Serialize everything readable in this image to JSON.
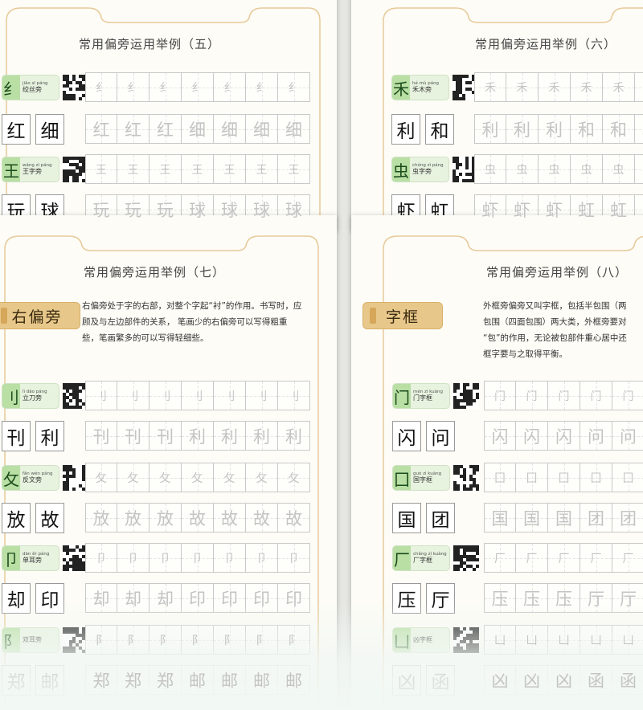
{
  "pages": [
    {
      "title": "常用偏旁运用举例（五）",
      "rows": [
        {
          "type": "head",
          "glyph": "纟",
          "pinyin": "jiǎo sī páng",
          "name": "绞丝旁",
          "trace": [
            "纟",
            "纟",
            "纟",
            "纟",
            "纟",
            "纟",
            "纟"
          ]
        },
        {
          "type": "ex",
          "ex": [
            "红",
            "细"
          ],
          "trace": [
            "红",
            "红",
            "红",
            "细",
            "细",
            "细",
            "细"
          ]
        },
        {
          "type": "head",
          "glyph": "王",
          "pinyin": "wáng zì páng",
          "name": "王字旁",
          "trace": [
            "王",
            "王",
            "王",
            "王",
            "王",
            "王",
            "王"
          ]
        },
        {
          "type": "ex",
          "ex": [
            "玩",
            "球"
          ],
          "trace": [
            "玩",
            "玩",
            "玩",
            "球",
            "球",
            "球",
            "球"
          ]
        }
      ]
    },
    {
      "title": "常用偏旁运用举例（六）",
      "rows": [
        {
          "type": "head",
          "glyph": "禾",
          "pinyin": "hé mù páng",
          "name": "禾木旁",
          "trace": [
            "禾",
            "禾",
            "禾",
            "禾",
            "禾",
            "禾"
          ]
        },
        {
          "type": "ex",
          "ex": [
            "利",
            "和"
          ],
          "trace": [
            "利",
            "利",
            "利",
            "和",
            "和",
            "和"
          ]
        },
        {
          "type": "head",
          "glyph": "虫",
          "pinyin": "chóng zì páng",
          "name": "虫字旁",
          "trace": [
            "虫",
            "虫",
            "虫",
            "虫",
            "虫",
            "虫"
          ]
        },
        {
          "type": "ex",
          "ex": [
            "虾",
            "虹"
          ],
          "trace": [
            "虾",
            "虾",
            "虾",
            "虹",
            "虹",
            "虹"
          ]
        }
      ]
    },
    {
      "title": "常用偏旁运用举例（七）",
      "intro_title": "右偏旁",
      "intro_lines": [
        "右偏旁处于字的右部，对整个字起“衬”的作用。书写时，应",
        "顾及与左边部件的关系，  笔画少的右偏旁可以写得粗重",
        "些，笔画繁多的可以写得轻细些。"
      ],
      "rows": [
        {
          "type": "head",
          "glyph": "刂",
          "pinyin": "lì dāo páng",
          "name": "立刀旁",
          "trace": [
            "刂",
            "刂",
            "刂",
            "刂",
            "刂",
            "刂",
            "刂"
          ]
        },
        {
          "type": "ex",
          "ex": [
            "刊",
            "利"
          ],
          "trace": [
            "刊",
            "刊",
            "刊",
            "利",
            "利",
            "利",
            "利"
          ]
        },
        {
          "type": "head",
          "glyph": "攵",
          "pinyin": "fǎn wén páng",
          "name": "反文旁",
          "trace": [
            "攵",
            "攵",
            "攵",
            "攵",
            "攵",
            "攵",
            "攵"
          ]
        },
        {
          "type": "ex",
          "ex": [
            "放",
            "故"
          ],
          "trace": [
            "放",
            "放",
            "放",
            "故",
            "故",
            "故",
            "故"
          ]
        },
        {
          "type": "head",
          "glyph": "卩",
          "pinyin": "dān ěr páng",
          "name": "单耳旁",
          "trace": [
            "卩",
            "卩",
            "卩",
            "卩",
            "卩",
            "卩",
            "卩"
          ]
        },
        {
          "type": "ex",
          "ex": [
            "却",
            "印"
          ],
          "trace": [
            "却",
            "却",
            "却",
            "印",
            "印",
            "印",
            "印"
          ]
        },
        {
          "type": "head",
          "glyph": "阝",
          "pinyin": "",
          "name": "双耳旁",
          "trace": [
            "阝",
            "阝",
            "阝",
            "阝",
            "阝",
            "阝",
            "阝"
          ]
        },
        {
          "type": "ex",
          "ex": [
            "郑",
            "邮"
          ],
          "trace": [
            "郑",
            "郑",
            "郑",
            "邮",
            "邮",
            "邮",
            "邮"
          ]
        }
      ]
    },
    {
      "title": "常用偏旁运用举例（八）",
      "intro_title": "字框",
      "intro_lines": [
        "外框旁偏旁又叫字框，包括半包围（两",
        "包围（四面包围）两大类，外框旁要对",
        "“包”的作用，无论被包部件重心居中还",
        "框字要与之取得平衡。"
      ],
      "rows": [
        {
          "type": "head",
          "glyph": "门",
          "pinyin": "mén zì kuàng",
          "name": "门字框",
          "trace": [
            "门",
            "门",
            "门",
            "门",
            "门"
          ]
        },
        {
          "type": "ex",
          "ex": [
            "闪",
            "问"
          ],
          "trace": [
            "闪",
            "闪",
            "闪",
            "问",
            "问"
          ]
        },
        {
          "type": "head",
          "glyph": "囗",
          "pinyin": "guó zì kuàng",
          "name": "国字框",
          "trace": [
            "囗",
            "囗",
            "囗",
            "囗",
            "囗"
          ]
        },
        {
          "type": "ex",
          "ex": [
            "国",
            "团"
          ],
          "trace": [
            "国",
            "国",
            "国",
            "团",
            "团"
          ]
        },
        {
          "type": "head",
          "glyph": "厂",
          "pinyin": "chǎng zì kuàng",
          "name": "厂字框",
          "trace": [
            "厂",
            "厂",
            "厂",
            "厂",
            "厂"
          ]
        },
        {
          "type": "ex",
          "ex": [
            "压",
            "厅"
          ],
          "trace": [
            "压",
            "压",
            "压",
            "厅",
            "厅"
          ]
        },
        {
          "type": "head",
          "glyph": "凵",
          "pinyin": "",
          "name": "凶字框",
          "trace": [
            "凵",
            "凵",
            "凵",
            "凵",
            "凵"
          ]
        },
        {
          "type": "ex",
          "ex": [
            "凶",
            "函"
          ],
          "trace": [
            "凶",
            "凶",
            "凶",
            "函",
            "函"
          ]
        }
      ]
    }
  ],
  "colors": {
    "accent_gold": "#e8c88a",
    "radical_green": "#b9dfa5",
    "frame_line": "#e7c99a"
  }
}
